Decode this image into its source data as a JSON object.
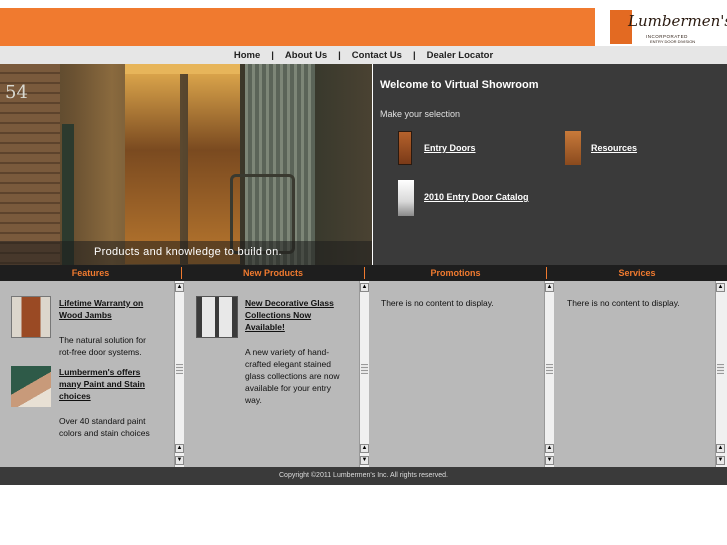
{
  "logo": {
    "script": "Lumbermen's",
    "line1": "INCORPORATED",
    "line2": "ENTRY DOOR DIVISION"
  },
  "nav": {
    "items": [
      "Home",
      "About Us",
      "Contact Us",
      "Dealer Locator"
    ],
    "separator": "|"
  },
  "hero": {
    "house_number": "54",
    "caption": "Products and knowledge to build on."
  },
  "showroom": {
    "title": "Welcome to Virtual Showroom",
    "subtitle": "Make your selection",
    "links": [
      "Entry Doors",
      "Resources",
      "2010 Entry Door Catalog"
    ]
  },
  "tabs": [
    "Features",
    "New Products",
    "Promotions",
    "Services"
  ],
  "features": {
    "item1_title_l1": "Lifetime Warranty on",
    "item1_title_l2": "Wood Jambs",
    "item1_text_l1": "The natural solution for",
    "item1_text_l2": "rot-free door systems.",
    "item2_title_l1": "Lumbermen's offers",
    "item2_title_l2": "many Paint and Stain",
    "item2_title_l3": "choices",
    "item2_text_l1": "Over 40 standard paint",
    "item2_text_l2": "colors and stain choices"
  },
  "new_products": {
    "title_l1": "New Decorative Glass",
    "title_l2": "Collections Now",
    "title_l3": "Available!",
    "text_l1": "A new variety of hand-",
    "text_l2": "crafted elegant stained",
    "text_l3": "glass collections are now",
    "text_l4": "available for your entry",
    "text_l5": "way."
  },
  "promotions": {
    "empty": "There is no content to display."
  },
  "services": {
    "empty": "There is no content to display."
  },
  "footer": {
    "copyright": "Copyright ©2011  Lumbermen's Inc. All rights reserved."
  },
  "colors": {
    "brand_orange": "#f07a2f",
    "dark_panel": "#3a3a3a",
    "content_gray": "#b9b9b9"
  }
}
